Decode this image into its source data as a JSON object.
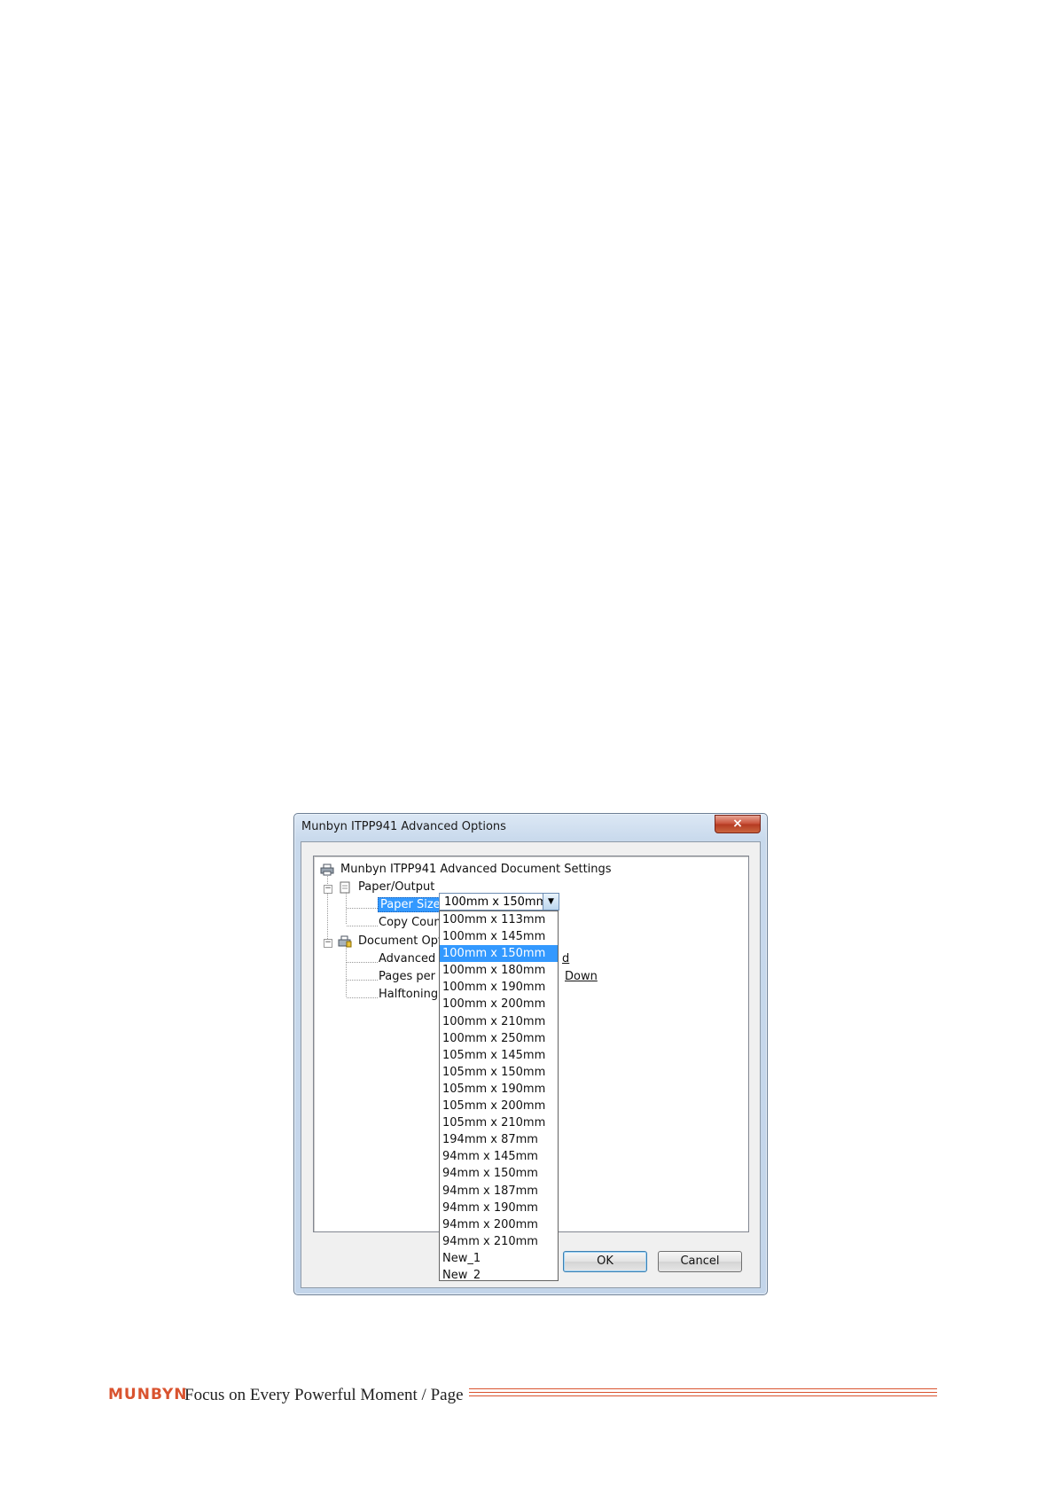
{
  "dialog": {
    "title": "Munbyn ITPP941 Advanced Options",
    "close_symbol": "×"
  },
  "tree": {
    "root": "Munbyn ITPP941 Advanced Document Settings",
    "paper_output": "Paper/Output",
    "paper_size_label": "Paper Size:",
    "copy_count_label": "Copy Count",
    "document_options": "Document Opti",
    "advanced_label": "Advanced P",
    "advanced_value_tail": "d",
    "pages_per_sheet_label": "Pages per Sl",
    "pages_per_sheet_value_tail": "Down",
    "halftoning_label": "Halftoning:"
  },
  "paper_size": {
    "selected": "100mm x 150mm",
    "options": [
      "100mm x 113mm",
      "100mm x 145mm",
      "100mm x 150mm",
      "100mm x 180mm",
      "100mm x 190mm",
      "100mm x 200mm",
      "100mm x 210mm",
      "100mm x 250mm",
      "105mm x 145mm",
      "105mm x 150mm",
      "105mm x 190mm",
      "105mm x 200mm",
      "105mm x 210mm",
      "194mm x 87mm",
      "94mm x 145mm",
      "94mm x 150mm",
      "94mm x 187mm",
      "94mm x 190mm",
      "94mm x 200mm",
      "94mm x 210mm",
      "New_1",
      "New_2"
    ],
    "highlighted_index": 2
  },
  "buttons": {
    "ok": "OK",
    "cancel": "Cancel"
  },
  "footer": {
    "brand": "MUNBYN",
    "tagline": "Focus on Every Powerful Moment / Page",
    "accent_color": "#d9532f"
  }
}
